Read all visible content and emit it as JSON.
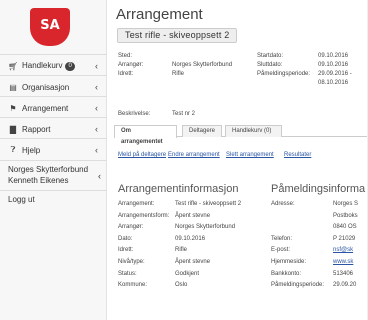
{
  "logo": {
    "text": "SA",
    "color": "#d9262c"
  },
  "sidebar": {
    "items": [
      {
        "icon": "cart-icon",
        "label": "Handlekurv",
        "badge": "0"
      },
      {
        "icon": "building-icon",
        "label": "Organisasjon"
      },
      {
        "icon": "flag-icon",
        "label": "Arrangement"
      },
      {
        "icon": "chart-icon",
        "label": "Rapport"
      },
      {
        "icon": "question-icon",
        "label": "Hjelp"
      }
    ],
    "user": {
      "org": "Norges Skytterforbund",
      "name": "Kenneth Eikenes"
    },
    "logout": "Logg ut"
  },
  "page": {
    "title": "Arrangement",
    "event_title": "Test rifle - skiveoppsett 2"
  },
  "summary_left": [
    {
      "k": "Sted:",
      "v": ""
    },
    {
      "k": "Arrangør:",
      "v": "Norges Skytterforbund"
    },
    {
      "k": "Idrett:",
      "v": "Rifle"
    }
  ],
  "summary_right": [
    {
      "k": "Startdato:",
      "v": "09.10.2016"
    },
    {
      "k": "Sluttdato:",
      "v": "09.10.2016"
    },
    {
      "k": "Påmeldingsperiode:",
      "v": "29.09.2016 -"
    },
    {
      "k": "",
      "v": "08.10.2016"
    }
  ],
  "description": {
    "k": "Beskrivelse:",
    "v": "Test nr 2"
  },
  "tabs": [
    {
      "label": "Om arrangementet",
      "active": true
    },
    {
      "label": "Deltagere",
      "active": false
    },
    {
      "label": "Handlekurv (0)",
      "active": false
    }
  ],
  "action_links": [
    "Meld på deltagere",
    "Endre arrangement",
    "Slett arrangement",
    "Resultater"
  ],
  "info_section": {
    "title": "Arrangementinformasjon",
    "rows": [
      {
        "k": "Arrangement:",
        "v": "Test rifle - skiveoppsett 2"
      },
      {
        "k": "Arrangementsform:",
        "v": "Åpent stevne"
      },
      {
        "k": "Arrangør:",
        "v": "Norges Skytterforbund"
      },
      {
        "k": "Dato:",
        "v": "09.10.2016"
      },
      {
        "k": "Idrett:",
        "v": "Rifle"
      },
      {
        "k": "Nivå/type:",
        "v": "Åpent stevne"
      },
      {
        "k": "Status:",
        "v": "Godkjent"
      },
      {
        "k": "Kommune:",
        "v": "Oslo"
      }
    ]
  },
  "signup_section": {
    "title": "Påmeldingsinforma",
    "rows": [
      {
        "k": "Adresse:",
        "v": "Norges S"
      },
      {
        "k": "",
        "v": "Postboks"
      },
      {
        "k": "",
        "v": "0840 OS"
      },
      {
        "k": "Telefon:",
        "v": "P 21029"
      },
      {
        "k": "E-post:",
        "v": "nsf@sk"
      },
      {
        "k": "Hjemmeside:",
        "v": "www.sk"
      },
      {
        "k": "Bankkonto:",
        "v": "513406"
      },
      {
        "k": "Påmeldingsperiode:",
        "v": "29.09.20"
      }
    ]
  }
}
